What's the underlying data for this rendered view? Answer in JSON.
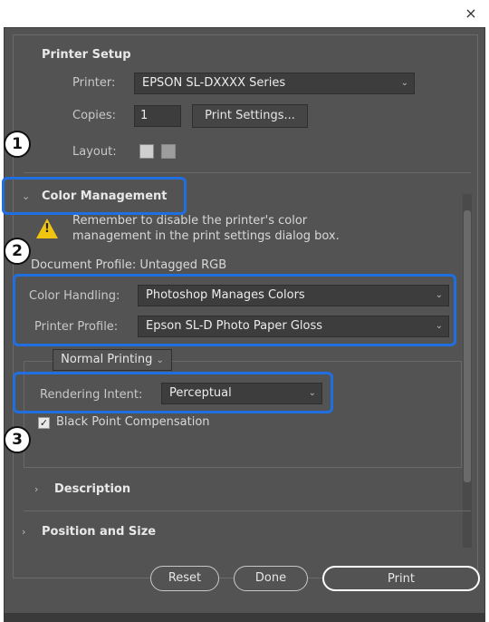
{
  "window": {
    "close_glyph": "×"
  },
  "printer_setup": {
    "title": "Printer Setup",
    "printer_label": "Printer:",
    "printer_value": "EPSON SL-DXXXX Series",
    "copies_label": "Copies:",
    "copies_value": "1",
    "print_settings_button": "Print Settings...",
    "layout_label": "Layout:"
  },
  "color_management": {
    "title": "Color Management",
    "warning_line1": "Remember to disable the printer's color",
    "warning_line2": "management in the print settings dialog box.",
    "document_profile": "Document Profile: Untagged RGB",
    "color_handling_label": "Color Handling:",
    "color_handling_value": "Photoshop Manages Colors",
    "printer_profile_label": "Printer Profile:",
    "printer_profile_value": "Epson SL-D      Photo Paper Gloss",
    "normal_printing": "Normal Printing",
    "rendering_intent_label": "Rendering Intent:",
    "rendering_intent_value": "Perceptual",
    "black_point_label": "Black Point Compensation",
    "black_point_checked": true
  },
  "sections": {
    "description": "Description",
    "position_size": "Position and Size"
  },
  "footer": {
    "reset": "Reset",
    "done": "Done",
    "print": "Print"
  },
  "callouts": [
    "1",
    "2",
    "3"
  ],
  "colors": {
    "callout_border": "#1f6fe0",
    "dialog_bg": "#535353",
    "warning_yellow": "#f1c40f"
  },
  "icons": {
    "close": "close-icon",
    "warning": "warning-icon",
    "chevron": "chevron-down-icon",
    "expand": "chevron-right-icon",
    "collapse": "chevron-down-icon",
    "layout_portrait": "portrait-layout-icon",
    "layout_landscape": "landscape-layout-icon"
  }
}
